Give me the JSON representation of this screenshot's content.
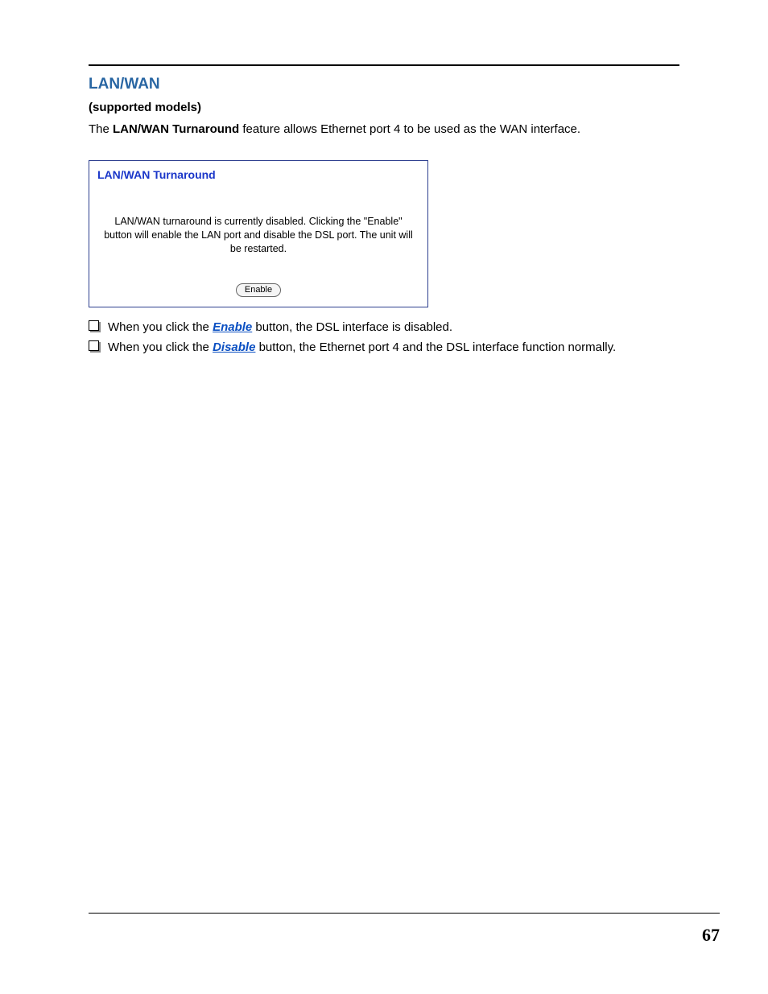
{
  "section_title": "LAN/WAN",
  "subhead": "(supported models)",
  "intro_pre": "The ",
  "intro_bold": "LAN/WAN Turnaround",
  "intro_post": " feature allows Ethernet port 4 to be used as the WAN interface.",
  "panel": {
    "title": "LAN/WAN Turnaround",
    "message": "LAN/WAN turnaround is currently disabled. Clicking the \"Enable\" button will enable the LAN port and disable the DSL port. The unit will be restarted.",
    "button_label": "Enable"
  },
  "bullets": [
    {
      "pre": "When you click the ",
      "kw": "Enable",
      "post": " button, the DSL interface is disabled."
    },
    {
      "pre": "When you click the ",
      "kw": "Disable",
      "post": " button, the Ethernet port 4 and the DSL interface function normally."
    }
  ],
  "page_number": "67"
}
